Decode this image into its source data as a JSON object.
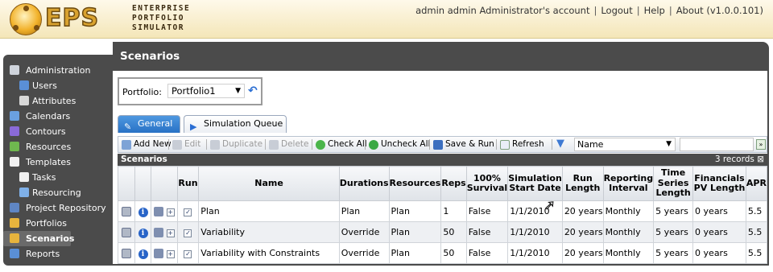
{
  "header": {
    "logo_text": "EPS",
    "tagline": [
      "ENTERPRISE",
      "PORTFOLIO",
      "SIMULATOR"
    ],
    "nav": [
      "admin admin Administrator's account",
      "Logout",
      "Help",
      "About (v1.0.0.101)"
    ]
  },
  "sidebar": {
    "items": [
      {
        "label": "Administration",
        "icon": "gear-icon",
        "color": "#cfd4dc"
      },
      {
        "label": "Users",
        "icon": "users-icon",
        "color": "#5a8fd6",
        "sub": true
      },
      {
        "label": "Attributes",
        "icon": "attributes-icon",
        "color": "#d8d8d8",
        "sub": true
      },
      {
        "label": "Calendars",
        "icon": "calendar-icon",
        "color": "#6aa0e0"
      },
      {
        "label": "Contours",
        "icon": "contours-icon",
        "color": "#8a6ad8"
      },
      {
        "label": "Resources",
        "icon": "resources-icon",
        "color": "#6fb84f"
      },
      {
        "label": "Templates",
        "icon": "templates-icon",
        "color": "#f0f0f0"
      },
      {
        "label": "Tasks",
        "icon": "tasks-icon",
        "color": "#f0f0f0",
        "sub": true
      },
      {
        "label": "Resourcing",
        "icon": "resourcing-icon",
        "color": "#7fb0e8",
        "sub": true
      },
      {
        "label": "Project Repository",
        "icon": "repository-icon",
        "color": "#5f86c4"
      },
      {
        "label": "Portfolios",
        "icon": "folder-icon",
        "color": "#e7b43d"
      },
      {
        "label": "Scenarios",
        "icon": "scenarios-icon",
        "color": "#e7b43d",
        "active": true
      },
      {
        "label": "Reports",
        "icon": "reports-icon",
        "color": "#5a8fd6"
      }
    ]
  },
  "page": {
    "title": "Scenarios"
  },
  "portfolio": {
    "label": "Portfolio:",
    "value": "Portfolio1"
  },
  "tabs": [
    {
      "label": "General",
      "active": true
    },
    {
      "label": "Simulation Queue",
      "active": false
    }
  ],
  "toolbar": {
    "add_new": "Add New",
    "edit": "Edit",
    "duplicate": "Duplicate",
    "delete": "Delete",
    "check_all": "Check All",
    "uncheck_all": "Uncheck All",
    "save_run": "Save & Run",
    "refresh": "Refresh",
    "sort_value": "Name",
    "search_value": ""
  },
  "grid": {
    "title": "Scenarios",
    "records": "3 records",
    "columns": [
      "",
      "",
      "",
      "Run",
      "Name",
      "Durations",
      "Resources",
      "Reps",
      "100% Survival",
      "Simulation Start Date",
      "Run Length",
      "Reporting Interval",
      "Time Series Length",
      "Financials PV Length",
      "APR"
    ],
    "rows": [
      {
        "name": "Plan",
        "durations": "Plan",
        "resources": "Plan",
        "reps": "1",
        "survival": "False",
        "start": "1/1/2010",
        "run_length": "20 years",
        "interval": "Monthly",
        "ts_length": "5 years",
        "pv_length": "0 years",
        "apr": "5.5"
      },
      {
        "name": "Variability",
        "durations": "Override",
        "resources": "Plan",
        "reps": "50",
        "survival": "False",
        "start": "1/1/2010",
        "run_length": "20 years",
        "interval": "Monthly",
        "ts_length": "5 years",
        "pv_length": "0 years",
        "apr": "5.5"
      },
      {
        "name": "Variability with Constraints",
        "durations": "Override",
        "resources": "Plan",
        "reps": "50",
        "survival": "False",
        "start": "1/1/2010",
        "run_length": "20 years",
        "interval": "Monthly",
        "ts_length": "5 years",
        "pv_length": "0 years",
        "apr": "5.5"
      }
    ]
  }
}
